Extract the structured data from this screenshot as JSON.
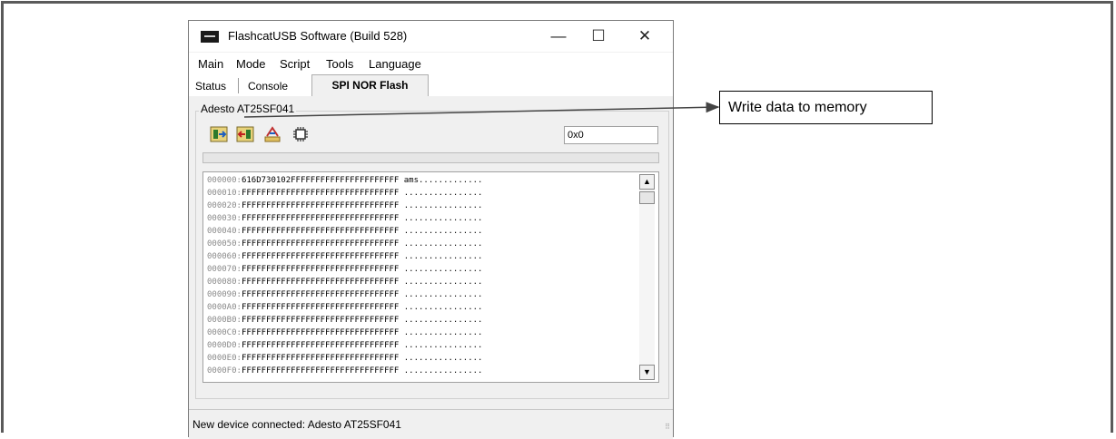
{
  "window": {
    "title": "FlashcatUSB Software (Build 528)",
    "controls": {
      "minimize": "—",
      "maximize": "☐",
      "close": "✕"
    }
  },
  "menu": {
    "items": [
      "Main",
      "Mode",
      "Script",
      "Tools",
      "Language"
    ]
  },
  "tabs": {
    "items": [
      "Status",
      "Console",
      "SPI NOR Flash"
    ],
    "active": "SPI NOR Flash"
  },
  "device_group": {
    "label": "Adesto AT25SF041",
    "toolbar_icons": [
      "read-memory-icon",
      "write-memory-icon",
      "verify-icon",
      "chip-icon"
    ],
    "address_value": "0x0"
  },
  "hex_view": {
    "rows": [
      {
        "addr": "000000:",
        "data": "616D730102FFFFFFFFFFFFFFFFFFFFFF",
        "ascii": "ams............."
      },
      {
        "addr": "000010:",
        "data": "FFFFFFFFFFFFFFFFFFFFFFFFFFFFFFFF",
        "ascii": "................"
      },
      {
        "addr": "000020:",
        "data": "FFFFFFFFFFFFFFFFFFFFFFFFFFFFFFFF",
        "ascii": "................"
      },
      {
        "addr": "000030:",
        "data": "FFFFFFFFFFFFFFFFFFFFFFFFFFFFFFFF",
        "ascii": "................"
      },
      {
        "addr": "000040:",
        "data": "FFFFFFFFFFFFFFFFFFFFFFFFFFFFFFFF",
        "ascii": "................"
      },
      {
        "addr": "000050:",
        "data": "FFFFFFFFFFFFFFFFFFFFFFFFFFFFFFFF",
        "ascii": "................"
      },
      {
        "addr": "000060:",
        "data": "FFFFFFFFFFFFFFFFFFFFFFFFFFFFFFFF",
        "ascii": "................"
      },
      {
        "addr": "000070:",
        "data": "FFFFFFFFFFFFFFFFFFFFFFFFFFFFFFFF",
        "ascii": "................"
      },
      {
        "addr": "000080:",
        "data": "FFFFFFFFFFFFFFFFFFFFFFFFFFFFFFFF",
        "ascii": "................"
      },
      {
        "addr": "000090:",
        "data": "FFFFFFFFFFFFFFFFFFFFFFFFFFFFFFFF",
        "ascii": "................"
      },
      {
        "addr": "0000A0:",
        "data": "FFFFFFFFFFFFFFFFFFFFFFFFFFFFFFFF",
        "ascii": "................"
      },
      {
        "addr": "0000B0:",
        "data": "FFFFFFFFFFFFFFFFFFFFFFFFFFFFFFFF",
        "ascii": "................"
      },
      {
        "addr": "0000C0:",
        "data": "FFFFFFFFFFFFFFFFFFFFFFFFFFFFFFFF",
        "ascii": "................"
      },
      {
        "addr": "0000D0:",
        "data": "FFFFFFFFFFFFFFFFFFFFFFFFFFFFFFFF",
        "ascii": "................"
      },
      {
        "addr": "0000E0:",
        "data": "FFFFFFFFFFFFFFFFFFFFFFFFFFFFFFFF",
        "ascii": "................"
      },
      {
        "addr": "0000F0:",
        "data": "FFFFFFFFFFFFFFFFFFFFFFFFFFFFFFFF",
        "ascii": "................"
      }
    ]
  },
  "status_bar": {
    "text": "New device connected: Adesto AT25SF041"
  },
  "callout": {
    "text": "Write data to memory"
  }
}
